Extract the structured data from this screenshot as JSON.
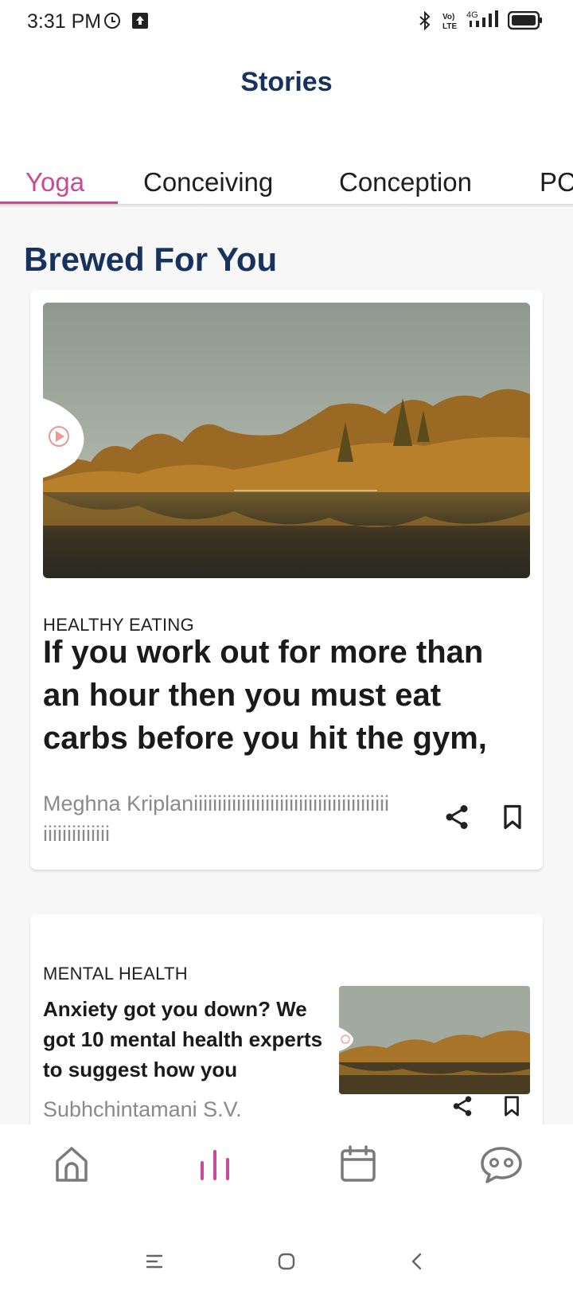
{
  "status_bar": {
    "time": "3:31 PM"
  },
  "header": {
    "title": "Stories"
  },
  "tabs": [
    {
      "label": "Yoga",
      "active": true
    },
    {
      "label": "Conceiving",
      "active": false
    },
    {
      "label": "Conception",
      "active": false
    },
    {
      "label": "PC",
      "active": false
    }
  ],
  "section": {
    "title": "Brewed For You"
  },
  "cards": [
    {
      "category": "HEALTHY EATING",
      "headline": "If you work out for more than an hour then you must eat carbs before you hit the gym,",
      "author": "Meghna Kriplaniiiiiiiiiiiiiiiiiiiiiiiiiiiiiiiiiiiiiiiiiiiiiiiiiiiiiii"
    },
    {
      "category": "MENTAL HEALTH",
      "headline": "Anxiety got you down? We got 10 mental health experts to suggest how you",
      "author": "Subhchintamani S.V."
    }
  ],
  "bottom_nav": [
    {
      "name": "home-icon",
      "active": false
    },
    {
      "name": "stories-icon",
      "active": true
    },
    {
      "name": "calendar-icon",
      "active": false
    },
    {
      "name": "chat-icon",
      "active": false
    }
  ],
  "colors": {
    "accent": "#c84b96",
    "title_blue": "#17325c",
    "muted": "#8a8a8a"
  }
}
